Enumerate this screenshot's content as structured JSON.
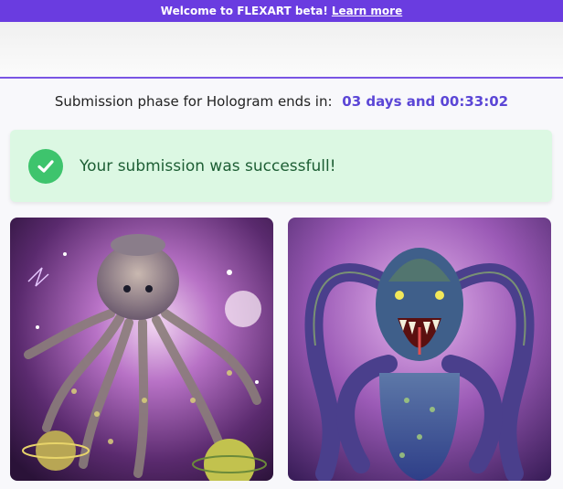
{
  "banner": {
    "text": "Welcome to FLEXART beta!",
    "link_label": "Learn more"
  },
  "phase": {
    "label": "Submission phase for Hologram ends in:",
    "countdown": "03 days and 00:33:02"
  },
  "alert": {
    "message": "Your submission was successfull!",
    "icon": "check-circle-icon"
  },
  "gallery": {
    "items": [
      {
        "subject": "purple-octopus-in-space-artwork"
      },
      {
        "subject": "purple-octopus-monster-artwork"
      }
    ]
  },
  "colors": {
    "brand": "#6a3ce0",
    "countdown": "#5b46d6",
    "success_bg": "#dcf8e3",
    "success_icon": "#3ec46d",
    "success_text": "#1d5e34"
  }
}
